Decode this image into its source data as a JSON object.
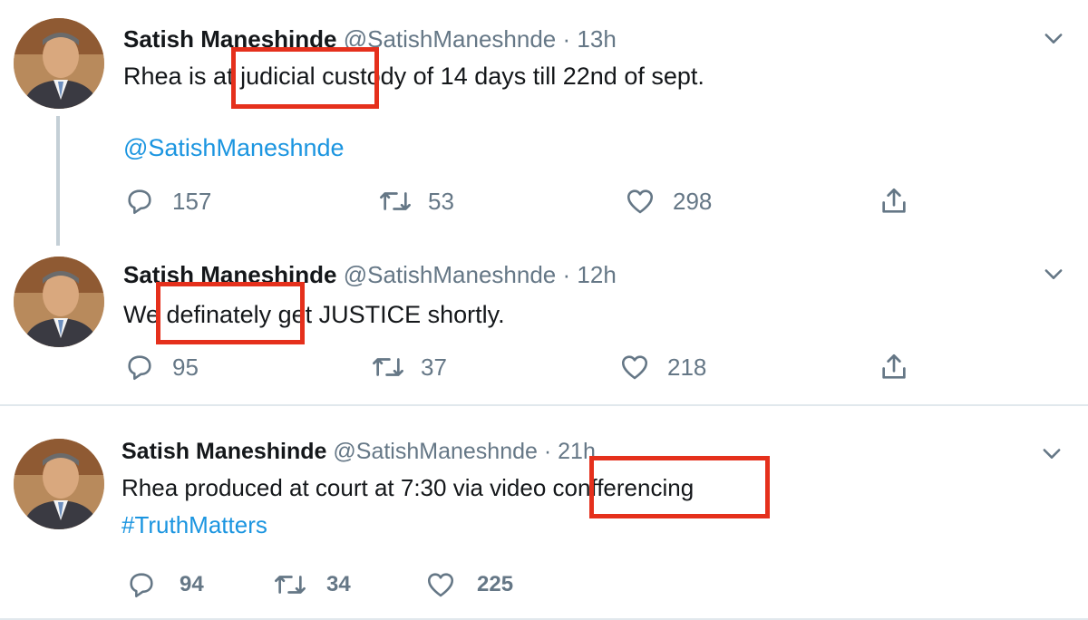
{
  "colors": {
    "link": "#1b95e0",
    "muted": "#657786",
    "highlight_box": "#e5301c"
  },
  "icons": [
    "reply-icon",
    "retweet-icon",
    "like-icon",
    "share-icon",
    "chevron-down-icon"
  ],
  "tweets": [
    {
      "name": "Satish Maneshinde",
      "handle": "@SatishManeshnde",
      "separator": "·",
      "time": "13h",
      "text": "Rhea is at judicial custody of 14 days till 22nd of sept.",
      "text_shown": "Rhea is at judicial custody of 14 days till 22nd of sept.",
      "mention": "@SatishManeshnde",
      "replies": "157",
      "retweets": "53",
      "likes": "298"
    },
    {
      "name": "Satish Maneshinde",
      "handle": "@SatishManeshnde",
      "separator": "·",
      "time": "12h",
      "text": "We definately get JUSTICE shortly.",
      "replies": "95",
      "retweets": "37",
      "likes": "218"
    },
    {
      "name": "Satish Maneshinde",
      "handle": "@SatishManeshnde",
      "separator": "·",
      "time": "21h",
      "text": "Rhea produced at court at 7:30 via video confferencing",
      "hashtag": "#TruthMatters",
      "replies": "94",
      "retweets": "34",
      "likes": "225"
    }
  ]
}
